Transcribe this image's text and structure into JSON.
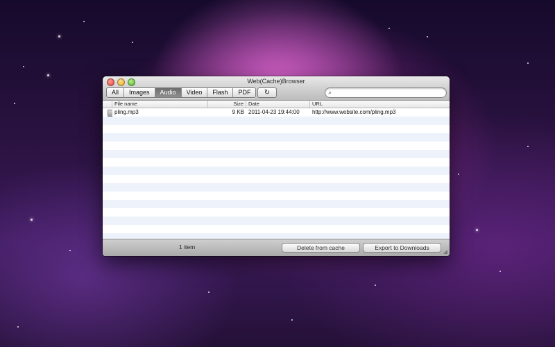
{
  "window": {
    "title": "Web(Cache)Browser"
  },
  "filters": {
    "tabs": [
      {
        "label": "All"
      },
      {
        "label": "Images"
      },
      {
        "label": "Audio"
      },
      {
        "label": "Video"
      },
      {
        "label": "Flash"
      },
      {
        "label": "PDF"
      }
    ],
    "selected": "Audio"
  },
  "toolbar": {
    "refresh_icon": "↻",
    "search_icon": "⌕",
    "search_value": ""
  },
  "table": {
    "columns": [
      "File name",
      "Size",
      "Date",
      "URL"
    ],
    "rows": [
      {
        "name": "pling.mp3",
        "size": "9 KB",
        "date": "2011-04-23 19:44:00",
        "url": "http://www.website.com/pling.mp3"
      }
    ]
  },
  "status": {
    "count": "1 item",
    "delete_label": "Delete from cache",
    "export_label": "Export to Downloads"
  },
  "colors": {
    "selected_tab": "#7a7a7a",
    "alt_row": "#eef2fb"
  }
}
